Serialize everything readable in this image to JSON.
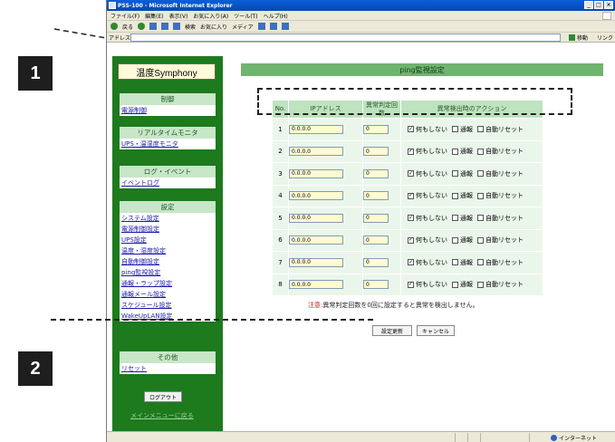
{
  "callouts": [
    "1",
    "2"
  ],
  "browser": {
    "title": "PSS-100 - Microsoft Internet Explorer",
    "win_buttons": [
      "_",
      "□",
      "×"
    ],
    "menu": [
      "ファイル(F)",
      "編集(E)",
      "表示(V)",
      "お気に入り(A)",
      "ツール(T)",
      "ヘルプ(H)"
    ],
    "toolbar": [
      "戻る",
      "検索",
      "お気に入り",
      "メディア"
    ],
    "address_label": "アドレス(D)",
    "go_label": "移動",
    "links_label": "リンク"
  },
  "sidebar": {
    "logo": "温度Symphony",
    "sections": [
      {
        "header": "制御",
        "items": [
          "電源制御"
        ]
      },
      {
        "header": "リアルタイムモニタ",
        "items": [
          "UPS・温湿度モニタ"
        ]
      },
      {
        "header": "ログ・イベント",
        "items": [
          "イベントログ"
        ]
      },
      {
        "header": "設定",
        "items": [
          "システム設定",
          "電源制御設定",
          "UPS設定",
          "温度・湿度設定",
          "自動制御設定",
          "ping監視設定",
          "通報・ラップ設定",
          "通報メール設定",
          "スケジュール設定",
          "WakeUpLAN設定"
        ]
      },
      {
        "header": "その他",
        "items": [
          "リセット"
        ]
      }
    ],
    "logout": "ログアウト",
    "footer_link": "メインメニューに戻る"
  },
  "main": {
    "title": "ping監視設定",
    "columns": [
      "No.",
      "IPアドレス",
      "異常判定回数",
      "異常検出時のアクション"
    ],
    "actions": [
      "何もしない",
      "通報",
      "自動リセット"
    ],
    "rows": [
      {
        "no": "1",
        "ip": "0.0.0.0",
        "count": "0",
        "checked": [
          true,
          false,
          false
        ]
      },
      {
        "no": "2",
        "ip": "0.0.0.0",
        "count": "0",
        "checked": [
          true,
          false,
          false
        ]
      },
      {
        "no": "3",
        "ip": "0.0.0.0",
        "count": "0",
        "checked": [
          true,
          false,
          false
        ]
      },
      {
        "no": "4",
        "ip": "0.0.0.0",
        "count": "0",
        "checked": [
          true,
          false,
          false
        ]
      },
      {
        "no": "5",
        "ip": "0.0.0.0",
        "count": "0",
        "checked": [
          true,
          false,
          false
        ]
      },
      {
        "no": "6",
        "ip": "0.0.0.0",
        "count": "0",
        "checked": [
          true,
          false,
          false
        ]
      },
      {
        "no": "7",
        "ip": "0.0.0.0",
        "count": "0",
        "checked": [
          true,
          false,
          false
        ]
      },
      {
        "no": "8",
        "ip": "0.0.0.0",
        "count": "0",
        "checked": [
          true,
          false,
          false
        ]
      }
    ],
    "note_prefix": "注意:",
    "note": "異常判定回数を0回に設定すると異常を検出しません。",
    "apply_button": "設定更新",
    "cancel_button": "キャンセル"
  },
  "status": {
    "zone": "インターネット"
  }
}
